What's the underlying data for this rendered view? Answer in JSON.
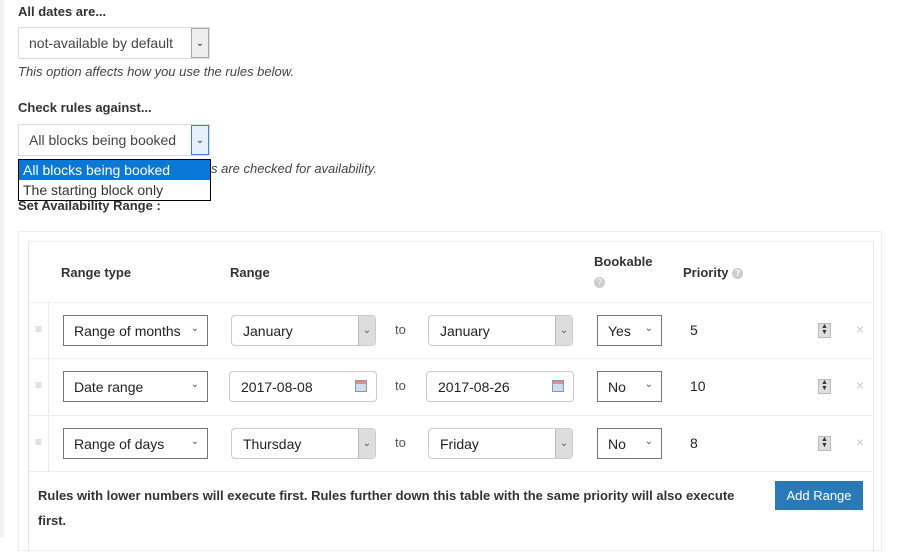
{
  "default_section": {
    "label": "All dates are...",
    "value": "not-available by default",
    "hint": "This option affects how you use the rules below."
  },
  "check_section": {
    "label": "Check rules against...",
    "value": "All blocks being booked",
    "hint_visible": "s are checked for availability.",
    "options": [
      "All blocks being booked",
      "The starting block only"
    ],
    "highlighted_option": "All blocks being booked"
  },
  "range_section": {
    "label": "Set Availability Range :"
  },
  "table": {
    "headers": {
      "range_type": "Range type",
      "range": "Range",
      "bookable": "Bookable",
      "priority": "Priority"
    },
    "to_label": "to",
    "rows": [
      {
        "type": "Range of months",
        "from": "January",
        "to": "January",
        "from_kind": "select",
        "bookable": "Yes",
        "priority": "5"
      },
      {
        "type": "Date range",
        "from": "2017-08-08",
        "to": "2017-08-26",
        "from_kind": "date",
        "bookable": "No",
        "priority": "10"
      },
      {
        "type": "Range of days",
        "from": "Thursday",
        "to": "Friday",
        "from_kind": "select",
        "bookable": "No",
        "priority": "8"
      }
    ],
    "footer_note": "Rules with lower numbers will execute first. Rules further down this table with the same priority will also execute first.",
    "add_button": "Add Range"
  },
  "colors": {
    "accent": "#2a7ab8",
    "highlight": "#0a78d7"
  },
  "icons": {
    "drag": "drag-handle-icon",
    "remove": "close-icon",
    "help": "help-icon",
    "calendar": "calendar-icon"
  }
}
